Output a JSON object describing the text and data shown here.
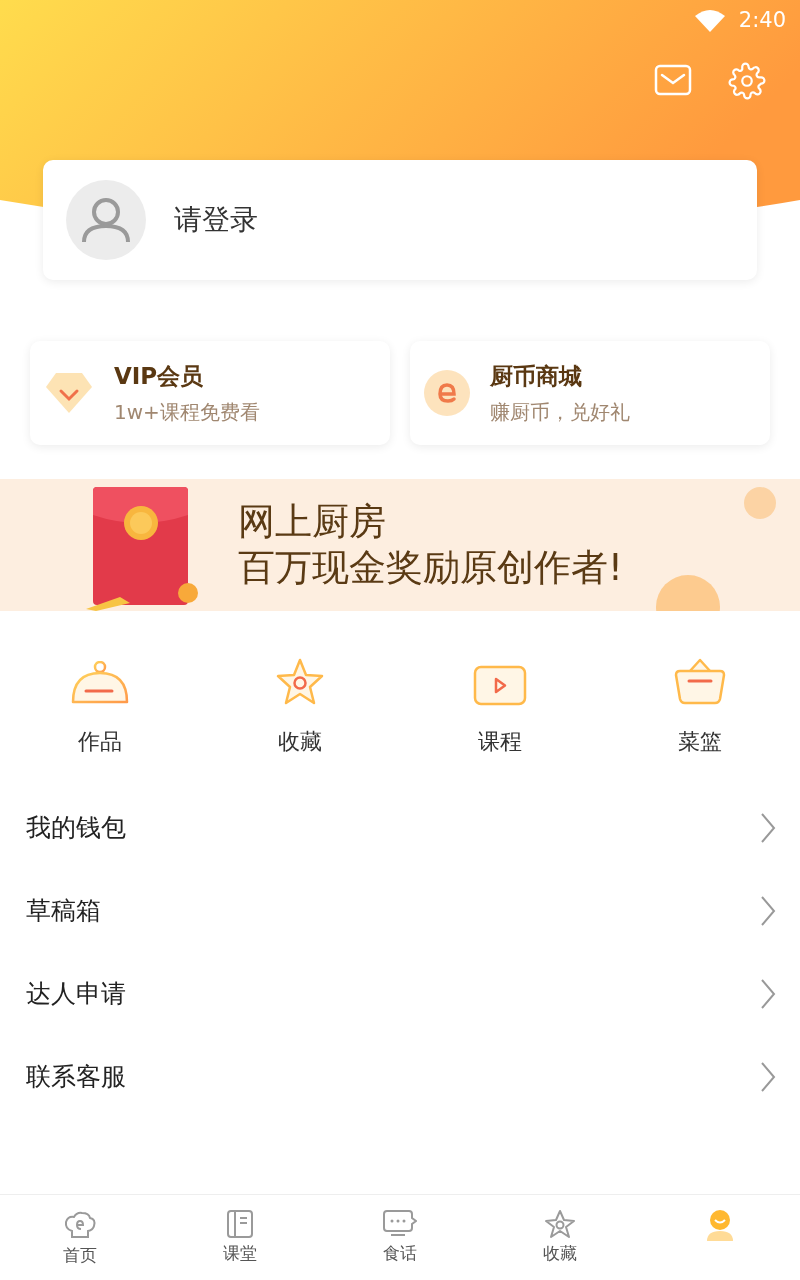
{
  "status_bar": {
    "time": "2:40"
  },
  "login": {
    "prompt": "请登录"
  },
  "feature_cards": [
    {
      "kind": "vip",
      "title": "VIP会员",
      "subtitle": "1w+课程免费看"
    },
    {
      "kind": "coin",
      "title": "厨币商城",
      "subtitle": "赚厨币，兑好礼"
    }
  ],
  "banner": {
    "line_1": "网上厨房",
    "line_2": "百万现金奖励原创作者!"
  },
  "shortcuts": [
    {
      "kind": "dish",
      "label": "作品"
    },
    {
      "kind": "star",
      "label": "收藏"
    },
    {
      "kind": "video",
      "label": "课程"
    },
    {
      "kind": "basket",
      "label": "菜篮"
    }
  ],
  "menu_items": [
    {
      "label": "我的钱包"
    },
    {
      "label": "草稿箱"
    },
    {
      "label": "达人申请"
    },
    {
      "label": "联系客服"
    }
  ],
  "tab_bar": [
    {
      "kind": "home",
      "label": "首页",
      "selected": false
    },
    {
      "kind": "class",
      "label": "课堂",
      "selected": false
    },
    {
      "kind": "chat",
      "label": "食话",
      "selected": false
    },
    {
      "kind": "star",
      "label": "收藏",
      "selected": false
    },
    {
      "kind": "me",
      "selected": true
    }
  ]
}
